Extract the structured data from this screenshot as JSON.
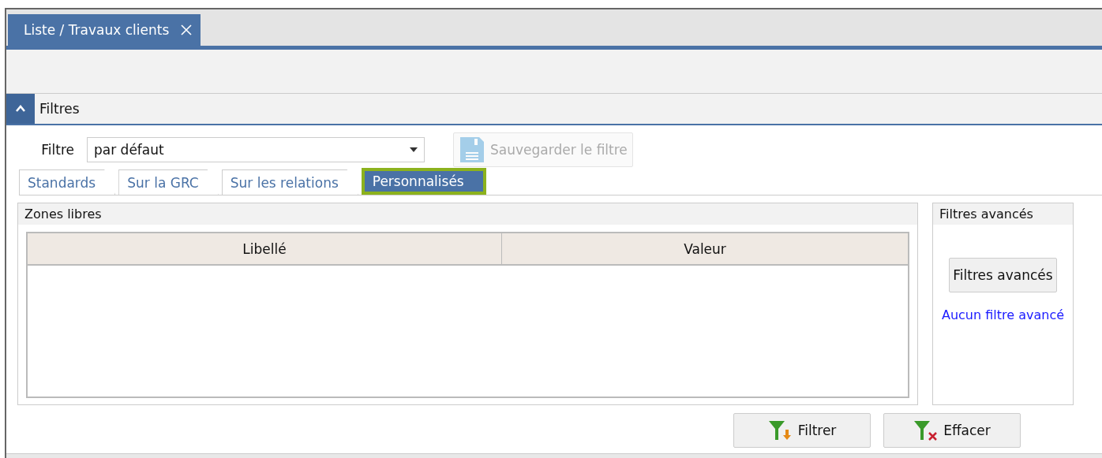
{
  "document_tabs": [
    {
      "label": "Liste / Travaux clients",
      "selected": true,
      "closable": true
    }
  ],
  "filters_section": {
    "title": "Filtres",
    "expanded": true
  },
  "filter": {
    "label": "Filtre",
    "value": "par défaut"
  },
  "save_button": {
    "label": "Sauvegarder le filtre",
    "disabled": true
  },
  "filter_tabs": [
    {
      "label": "Standards",
      "selected": false
    },
    {
      "label": "Sur la GRC",
      "selected": false
    },
    {
      "label": "Sur les relations",
      "selected": false
    },
    {
      "label": "Personnalisés",
      "selected": true
    }
  ],
  "free_zones": {
    "title": "Zones libres",
    "columns": [
      "Libellé",
      "Valeur"
    ]
  },
  "advanced_filters": {
    "title": "Filtres avancés",
    "button": "Filtres avancés",
    "status": "Aucun filtre avancé"
  },
  "actions": [
    {
      "kind": "filter",
      "label": "Filtrer"
    },
    {
      "kind": "clear",
      "label": "Effacer"
    }
  ]
}
